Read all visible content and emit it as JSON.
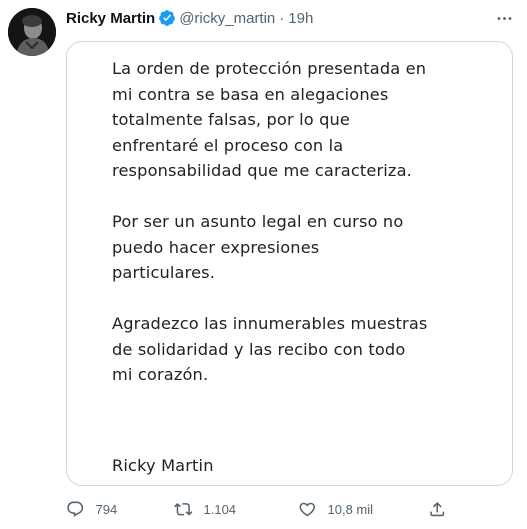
{
  "author": {
    "name": "Ricky Martin",
    "handle": "@ricky_martin",
    "separator": "·",
    "time": "19h",
    "verified": true
  },
  "media": {
    "paragraphs": [
      [
        "La orden de protección presentada en",
        "mi contra se basa en alegaciones",
        "totalmente falsas, por lo que",
        "enfrentaré el proceso con la",
        "responsabilidad que me caracteriza."
      ],
      [
        "Por ser un asunto legal en curso no",
        "puedo hacer expresiones",
        "particulares."
      ],
      [
        "Agradezco las innumerables muestras",
        "de solidaridad y las recibo con todo",
        "mi corazón."
      ]
    ],
    "signature": "Ricky Martin"
  },
  "actions": {
    "replies": "794",
    "retweets": "1.104",
    "likes": "10,8 mil"
  },
  "colors": {
    "verified": "#1d9bf0",
    "secondary_text": "#536471",
    "border": "#cfd9de"
  },
  "icons": [
    "more-icon",
    "verified-badge-icon",
    "reply-icon",
    "retweet-icon",
    "like-icon",
    "share-icon"
  ]
}
